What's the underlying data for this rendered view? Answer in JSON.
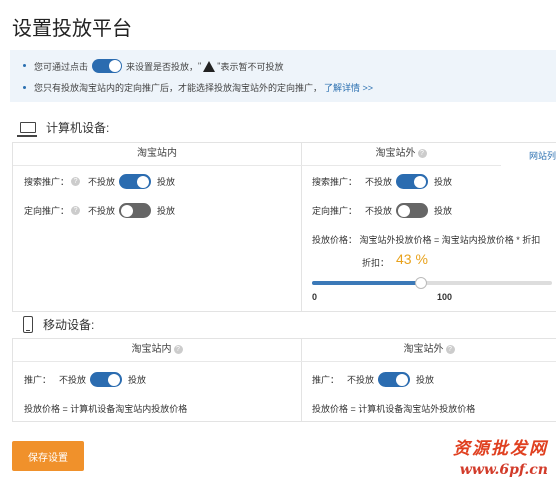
{
  "page_title": "设置投放平台",
  "notice": {
    "line1_before": "您可通过点击",
    "line1_after": "来设置是否投放，",
    "line1_quote_open": "\"",
    "line1_quote_close": "\"",
    "line1_warn": "表示暂不可投放",
    "line2": "您只有投放淘宝站内的定向推广后，才能选择投放淘宝站外的定向推广，",
    "line2_link": "了解详情 >>"
  },
  "computer": {
    "title": "计算机设备:",
    "col_inside": "淘宝站内",
    "col_outside": "淘宝站外",
    "site_list_link": "网站列",
    "inside_rows": [
      {
        "label": "搜索推广：",
        "off": "不投放",
        "on": "投放",
        "state": "on"
      },
      {
        "label": "定向推广：",
        "off": "不投放",
        "on": "投放",
        "state": "off"
      }
    ],
    "outside_rows": [
      {
        "label": "搜索推广：",
        "off": "不投放",
        "on": "投放",
        "state": "on"
      },
      {
        "label": "定向推广：",
        "off": "不投放",
        "on": "投放",
        "state": "off"
      }
    ],
    "price_formula": "投放价格：  淘宝站外投放价格 = 淘宝站内投放价格 * 折扣",
    "discount_label": "折扣：",
    "discount_value": "43 %",
    "discount_fraction": 0.43,
    "slider_min": "0",
    "slider_max": "100"
  },
  "mobile": {
    "title": "移动设备:",
    "col_inside": "淘宝站内",
    "col_outside": "淘宝站外",
    "inside_row": {
      "label": "推广：",
      "off": "不投放",
      "on": "投放",
      "state": "on"
    },
    "outside_row": {
      "label": "推广：",
      "off": "不投放",
      "on": "投放",
      "state": "on"
    },
    "inside_price": "投放价格 =  计算机设备淘宝站内投放价格",
    "outside_price": "投放价格 =  计算机设备淘宝站外投放价格"
  },
  "save_button": "保存设置",
  "watermark": {
    "line1": "资源批发网",
    "line2": "www.6pf.cn"
  },
  "colors": {
    "accent": "#2b6cb0",
    "save": "#f0912b",
    "discount": "#e8a21c"
  },
  "icons": [
    "laptop-icon",
    "phone-icon",
    "warning-icon",
    "help-icon"
  ]
}
